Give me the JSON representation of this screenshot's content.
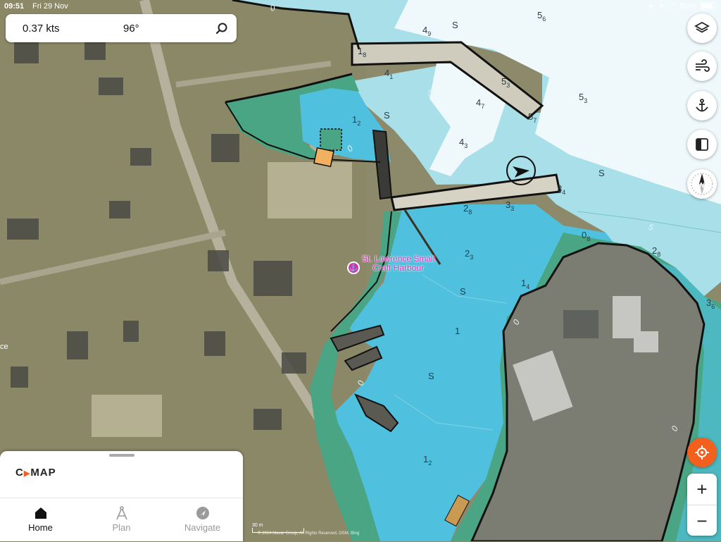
{
  "status_bar": {
    "time": "09:51",
    "date": "Fri 29 Nov",
    "battery": "80%"
  },
  "nav_info": {
    "speed": "0.37 kts",
    "heading": "96°"
  },
  "map": {
    "place_label": "St. Lawrence Small Craft Harbour",
    "place_label_line1": "St. Lawrence Small",
    "place_label_line2": "Craft Harbour",
    "edge_label": "ce",
    "scale_text": "30 m",
    "attribution": "© 2024 Maxar Group, All Rights Reserved, OSM, Bing",
    "depth_soundings": [
      {
        "main": "5",
        "sub": "6"
      },
      {
        "main": "4",
        "sub": "9"
      },
      {
        "main": "S",
        "sub": ""
      },
      {
        "main": "1",
        "sub": "8"
      },
      {
        "main": "4",
        "sub": "1"
      },
      {
        "main": "5",
        "sub": "3"
      },
      {
        "main": "5",
        "sub": "3"
      },
      {
        "main": "4",
        "sub": "7"
      },
      {
        "main": "5",
        "sub": "7"
      },
      {
        "main": "1",
        "sub": "2"
      },
      {
        "main": "S",
        "sub": ""
      },
      {
        "main": "4",
        "sub": "3"
      },
      {
        "main": "S",
        "sub": ""
      },
      {
        "main": "3",
        "sub": "4"
      },
      {
        "main": "2",
        "sub": "8"
      },
      {
        "main": "3",
        "sub": "3"
      },
      {
        "main": "0",
        "sub": "8"
      },
      {
        "main": "2",
        "sub": "3"
      },
      {
        "main": "2",
        "sub": "8"
      },
      {
        "main": "S",
        "sub": ""
      },
      {
        "main": "1",
        "sub": "4"
      },
      {
        "main": "3",
        "sub": "6"
      },
      {
        "main": "1",
        "sub": ""
      },
      {
        "main": "S",
        "sub": ""
      },
      {
        "main": "1",
        "sub": "2"
      }
    ],
    "contour_labels": [
      "0",
      "5",
      "0",
      "0",
      "5",
      "0",
      "0"
    ]
  },
  "controls": {
    "layers_icon": "layers-icon",
    "wind_icon": "wind-icon",
    "anchor_icon": "anchor-icon",
    "split_view_icon": "split-view-icon",
    "compass_label": "N",
    "zoom_in": "+",
    "zoom_out": "−"
  },
  "bottom_panel": {
    "logo_text": "C-MAP",
    "logo_left": "C",
    "logo_right": "MAP",
    "tabs": [
      {
        "label": "Home",
        "icon": "home-icon",
        "active": true
      },
      {
        "label": "Plan",
        "icon": "compass-drafting-icon",
        "active": false
      },
      {
        "label": "Navigate",
        "icon": "navigate-icon",
        "active": false
      }
    ]
  },
  "colors": {
    "accent": "#f3601d",
    "harbour_marker": "#d431b8",
    "deep_water": "#a8dfe9",
    "shallow_water": "#4fc1de",
    "intertidal": "#4aa584"
  }
}
